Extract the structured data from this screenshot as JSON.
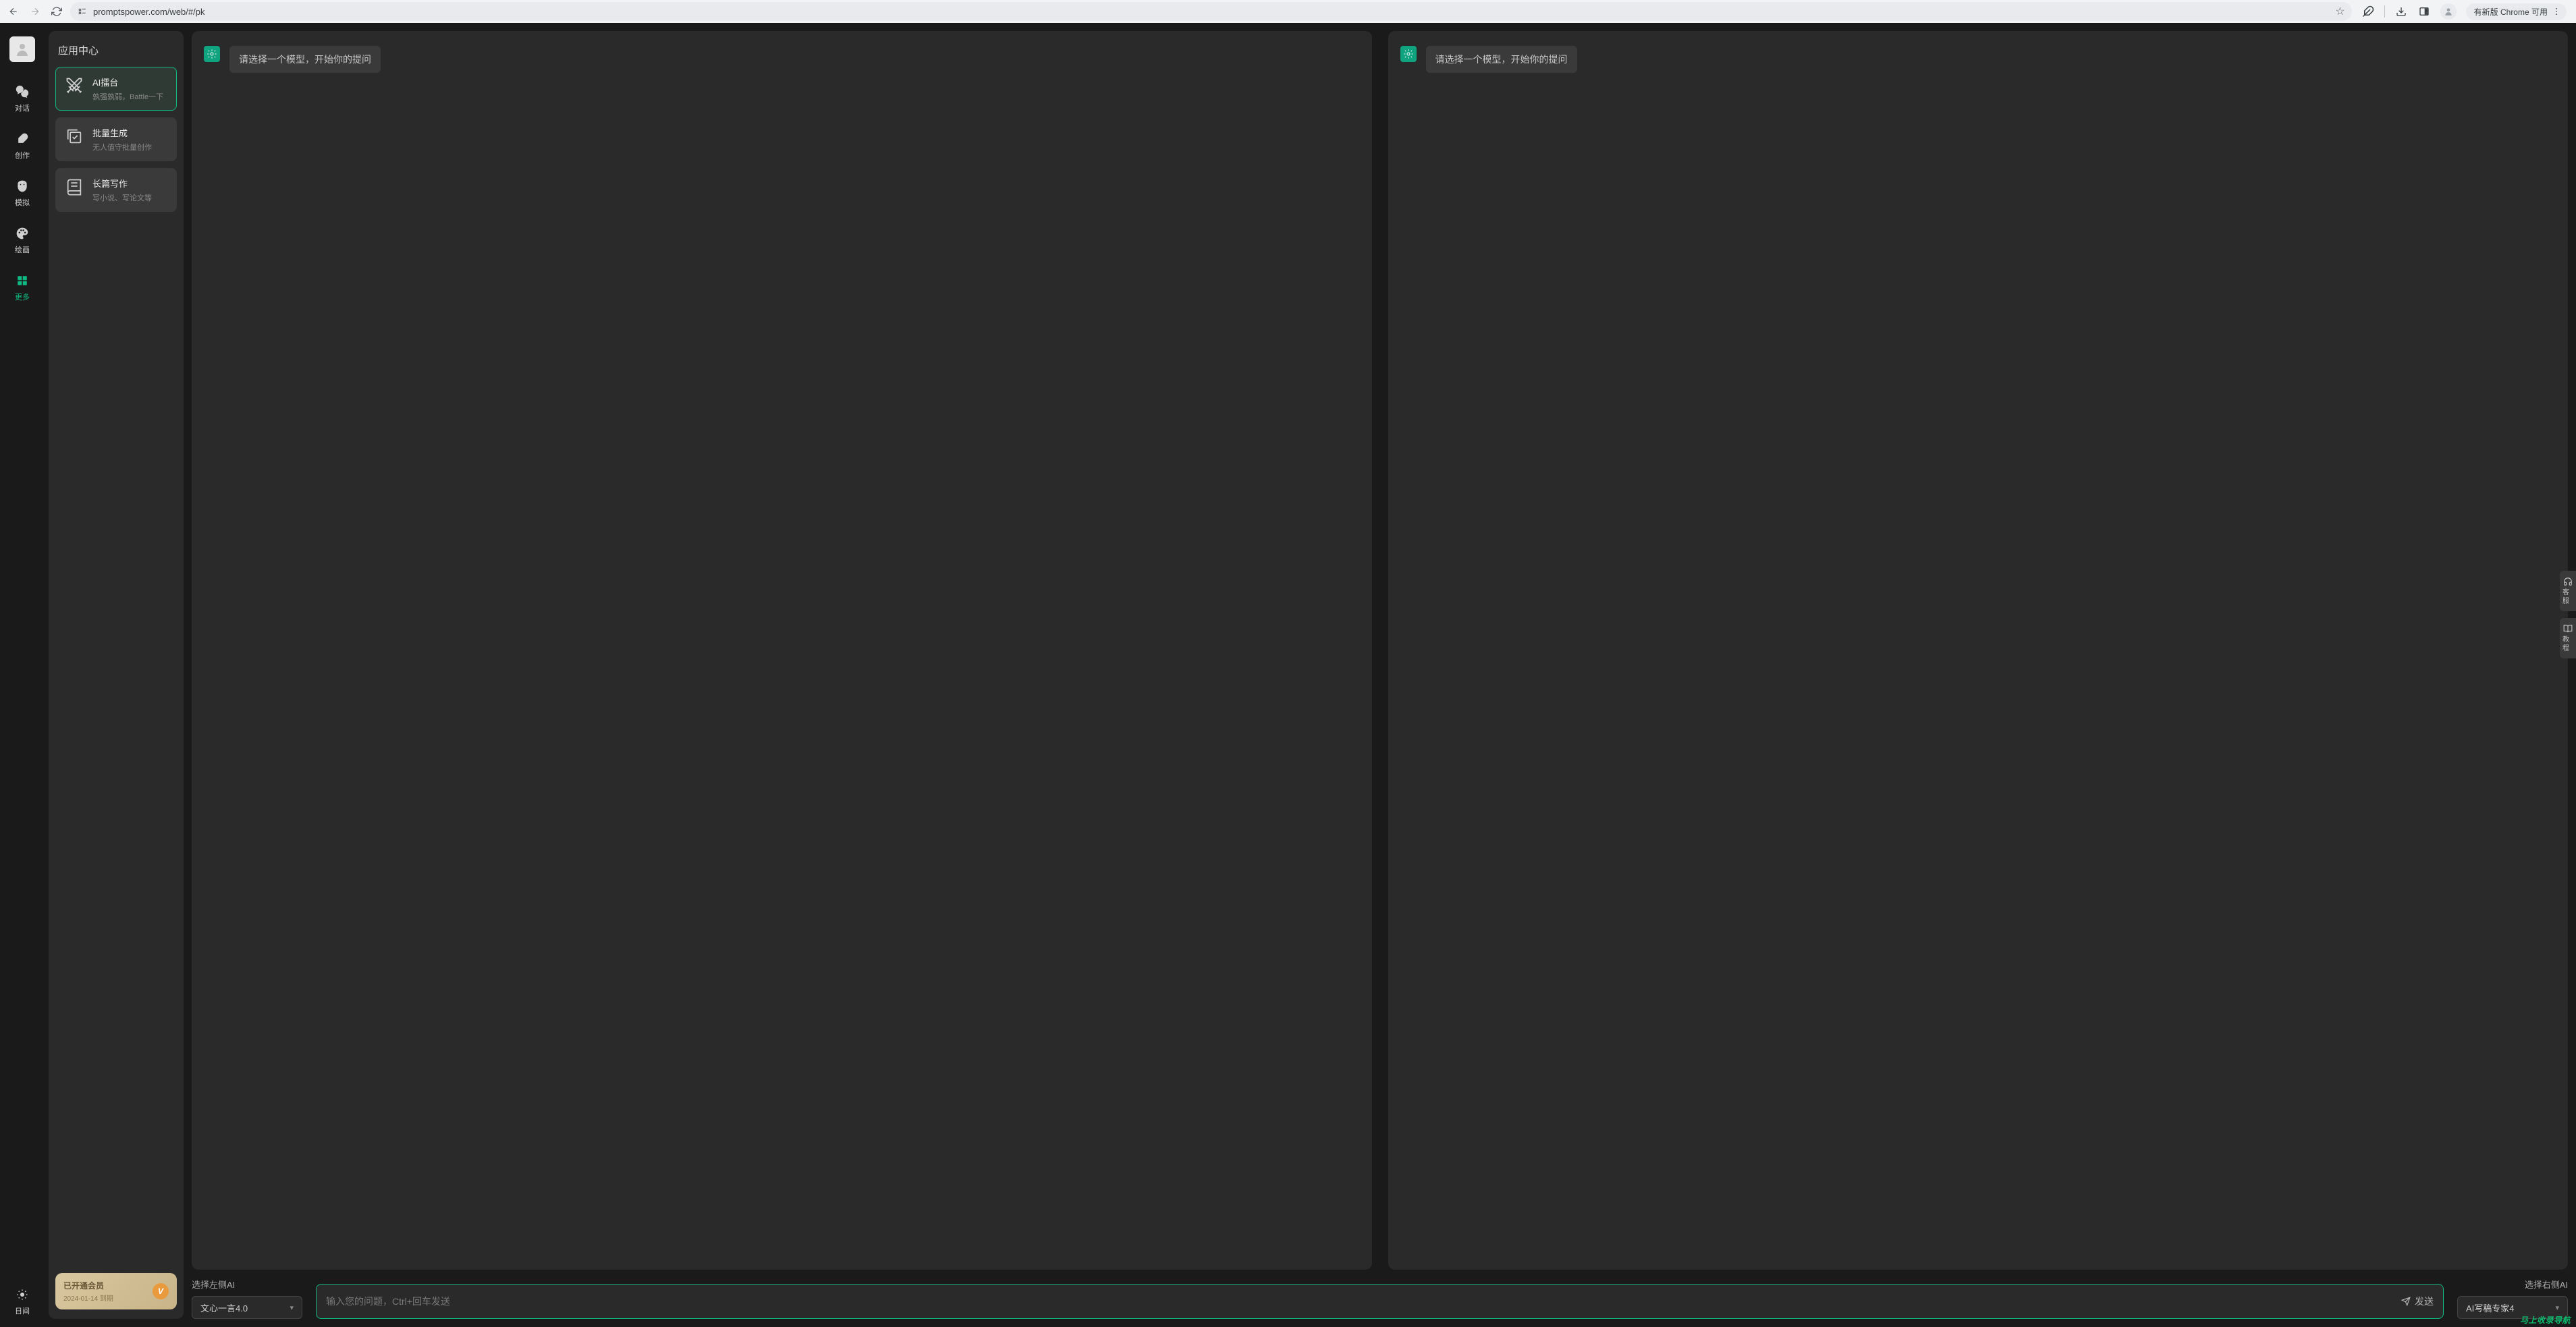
{
  "browser": {
    "url": "promptspower.com/web/#/pk",
    "update_label": "有新版 Chrome 可用"
  },
  "rail": {
    "items": [
      {
        "label": "对话",
        "icon": "chat"
      },
      {
        "label": "创作",
        "icon": "feather"
      },
      {
        "label": "模拟",
        "icon": "mask"
      },
      {
        "label": "绘画",
        "icon": "palette"
      },
      {
        "label": "更多",
        "icon": "grid"
      }
    ],
    "theme_label": "日间"
  },
  "sidebar": {
    "title": "应用中心",
    "cards": [
      {
        "title": "AI擂台",
        "subtitle": "孰强孰弱，Battle一下",
        "active": true
      },
      {
        "title": "批量生成",
        "subtitle": "无人值守批量创作",
        "active": false
      },
      {
        "title": "长篇写作",
        "subtitle": "写小说、写论文等",
        "active": false
      }
    ],
    "vip": {
      "title": "已开通会员",
      "date": "2024-01-14 到期",
      "badge": "V"
    }
  },
  "chat": {
    "left_message": "请选择一个模型，开始你的提问",
    "right_message": "请选择一个模型，开始你的提问"
  },
  "controls": {
    "left_label": "选择左侧AI",
    "left_model": "文心一言4.0",
    "right_label": "选择右侧AI",
    "right_model": "AI写稿专家4",
    "input_placeholder": "输入您的问题，Ctrl+回车发送",
    "send_label": "发送"
  },
  "float": {
    "service_label": "客服",
    "tutorial_label": "教程"
  },
  "watermark": "马上收录导航"
}
